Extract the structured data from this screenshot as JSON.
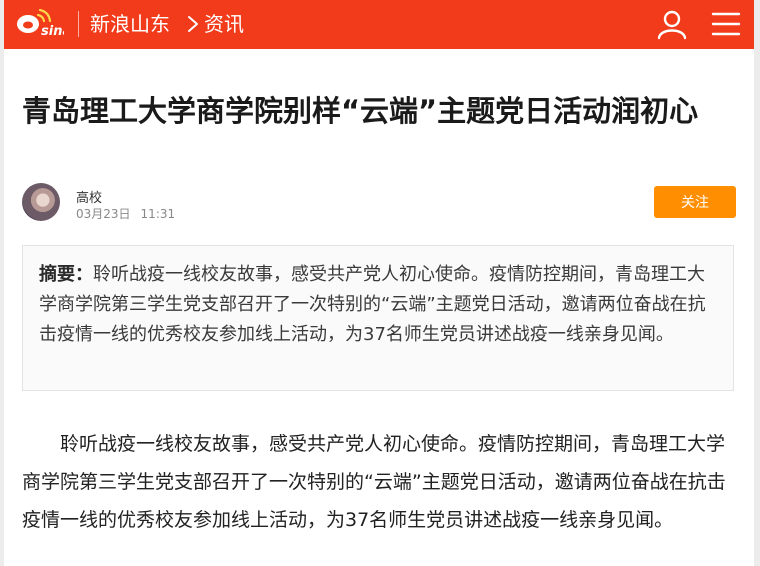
{
  "header": {
    "logo_text": "sina",
    "channel": "新浪山东",
    "section": "资讯",
    "colors": {
      "bar": "#f23b1b"
    }
  },
  "article": {
    "title": "青岛理工大学商学院别样“云端”主题党日活动润初心",
    "author": "高校",
    "date": "03月23日",
    "time": "11:31",
    "follow_label": "关注",
    "summary_label": "摘要：",
    "summary_text": "聆听战疫一线校友故事，感受共产党人初心使命。疫情防控期间，青岛理工大学商学院第三学生党支部召开了一次特别的“云端”主题党日活动，邀请两位奋战在抗击疫情一线的优秀校友参加线上活动，为37名师生党员讲述战疫一线亲身见闻。",
    "body_paragraph": "聆听战疫一线校友故事，感受共产党人初心使命。疫情防控期间，青岛理工大学商学院第三学生党支部召开了一次特别的“云端”主题党日活动，邀请两位奋战在抗击疫情一线的优秀校友参加线上活动，为37名师生党员讲述战疫一线亲身见闻。"
  },
  "icons": [
    "sina-logo-icon",
    "chevron-right-icon",
    "user-icon",
    "menu-icon"
  ],
  "accent_colors": {
    "follow_button": "#ff8f00"
  }
}
